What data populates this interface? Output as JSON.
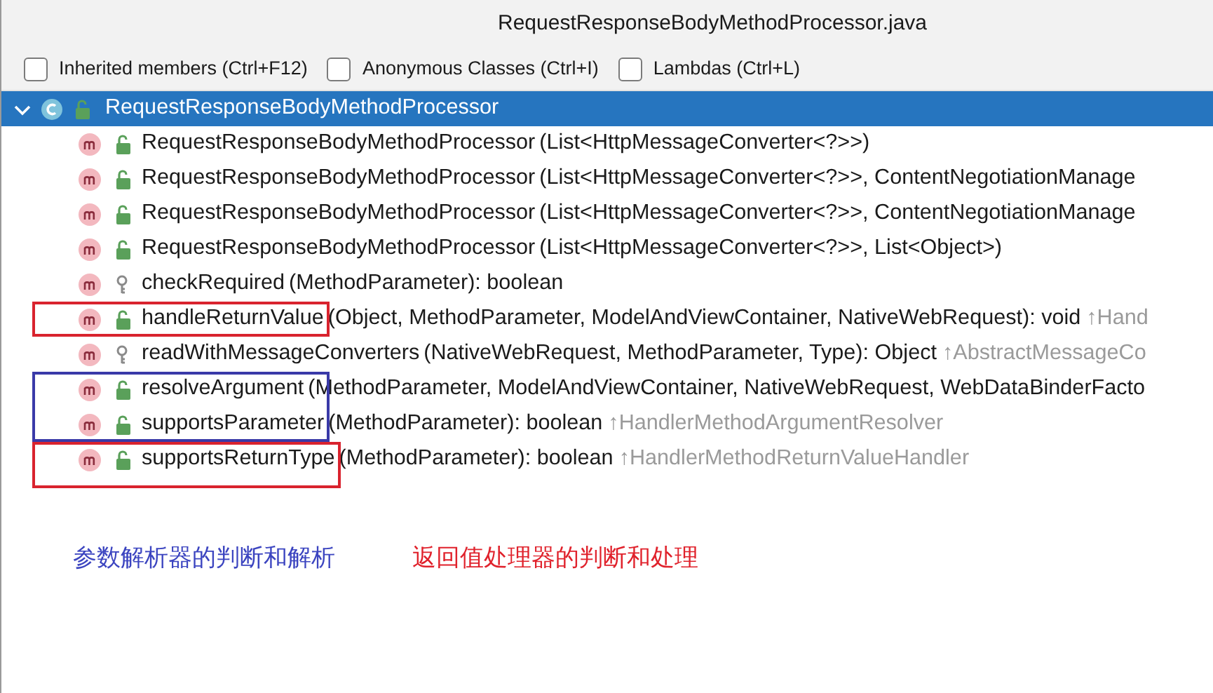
{
  "window": {
    "title": "RequestResponseBodyMethodProcessor.java"
  },
  "filters": [
    {
      "label": "Inherited members (Ctrl+F12)",
      "checked": false
    },
    {
      "label": "Anonymous Classes (Ctrl+I)",
      "checked": false
    },
    {
      "label": "Lambdas (Ctrl+L)",
      "checked": false
    }
  ],
  "tree": {
    "label": "RequestResponseBodyMethodProcessor",
    "expanded": true,
    "selected": true,
    "children": [
      {
        "name": "RequestResponseBodyMethodProcessor",
        "signature": "(List<HttpMessageConverter<?>>)",
        "kind": "public"
      },
      {
        "name": "RequestResponseBodyMethodProcessor",
        "signature": "(List<HttpMessageConverter<?>>, ContentNegotiationManage",
        "kind": "public"
      },
      {
        "name": "RequestResponseBodyMethodProcessor",
        "signature": "(List<HttpMessageConverter<?>>, ContentNegotiationManage",
        "kind": "public"
      },
      {
        "name": "RequestResponseBodyMethodProcessor",
        "signature": "(List<HttpMessageConverter<?>>, List<Object>)",
        "kind": "public"
      },
      {
        "name": "checkRequired",
        "signature": "(MethodParameter): boolean",
        "kind": "protected"
      },
      {
        "name": "handleReturnValue",
        "signature": "(Object, MethodParameter, ModelAndViewContainer, NativeWebRequest): void",
        "inherited": "↑Hand",
        "kind": "public",
        "color": "#d9232e"
      },
      {
        "name": "readWithMessageConverters",
        "signature": "(NativeWebRequest, MethodParameter, Type): Object",
        "inherited": "↑AbstractMessageCo",
        "kind": "protected"
      },
      {
        "name": "resolveArgument",
        "signature": "(MethodParameter, ModelAndViewContainer, NativeWebRequest, WebDataBinderFacto",
        "kind": "public",
        "color": "#3a3aa8"
      },
      {
        "name": "supportsParameter",
        "signature": "(MethodParameter): boolean",
        "inherited": "↑HandlerMethodArgumentResolver",
        "kind": "public",
        "color": "#3a3aa8"
      },
      {
        "name": "supportsReturnType",
        "signature": "(MethodParameter): boolean",
        "inherited": "↑HandlerMethodReturnValueHandler",
        "kind": "public",
        "color": "#d9232e"
      }
    ]
  },
  "captions": [
    {
      "text": "参数解析器的判断和解析",
      "color": "#3c45c0"
    },
    {
      "text": "返回值处理器的判断和处理",
      "color": "#e0222c"
    }
  ]
}
